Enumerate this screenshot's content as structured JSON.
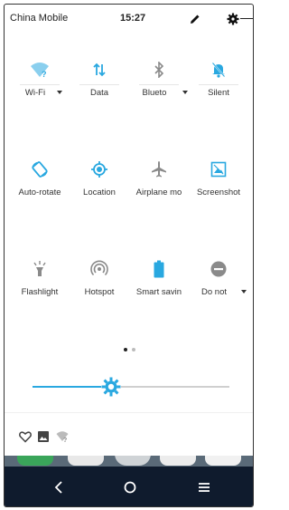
{
  "status_bar": {
    "carrier": "China Mobile",
    "time": "15:27",
    "icons": [
      "edit-icon",
      "settings-icon"
    ]
  },
  "quick_settings": [
    {
      "label": "Wi-Fi",
      "icon": "wifi-icon",
      "dropdown": true,
      "active": true
    },
    {
      "label": "Data",
      "icon": "data-arrows-icon",
      "dropdown": false,
      "active": true
    },
    {
      "label": "Blueto",
      "icon": "bluetooth-icon",
      "dropdown": true,
      "active": false
    },
    {
      "label": "Silent",
      "icon": "bell-off-icon",
      "dropdown": false,
      "active": true
    },
    {
      "label": "Auto-rotate",
      "icon": "rotate-icon",
      "dropdown": false,
      "active": true
    },
    {
      "label": "Location",
      "icon": "location-icon",
      "dropdown": false,
      "active": true
    },
    {
      "label": "Airplane mo",
      "icon": "airplane-icon",
      "dropdown": false,
      "active": false
    },
    {
      "label": "Screenshot",
      "icon": "screenshot-icon",
      "dropdown": false,
      "active": true
    },
    {
      "label": "Flashlight",
      "icon": "flashlight-icon",
      "dropdown": false,
      "active": false
    },
    {
      "label": "Hotspot",
      "icon": "hotspot-icon",
      "dropdown": false,
      "active": false
    },
    {
      "label": "Smart savin",
      "icon": "battery-icon",
      "dropdown": false,
      "active": true
    },
    {
      "label": "Do not",
      "icon": "do-not-disturb-icon",
      "dropdown": true,
      "active": false
    }
  ],
  "pager": {
    "pages": 2,
    "current": 1
  },
  "brightness": {
    "level": 0.4
  },
  "notification_icons": [
    "heart-icon",
    "image-icon",
    "wifi-icon"
  ],
  "navbar": [
    "back-icon",
    "home-icon",
    "recents-icon"
  ],
  "colors": {
    "accent": "#29a8e0",
    "inactive": "#8a8a8a",
    "navbar": "#0f1b2d"
  }
}
